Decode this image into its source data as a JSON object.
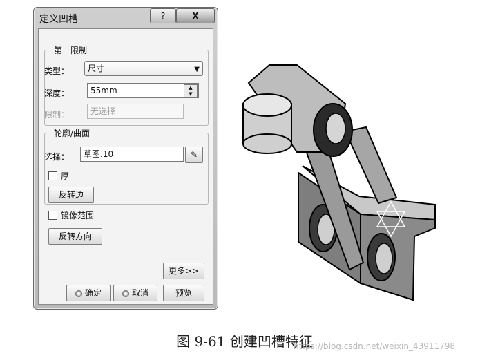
{
  "dialog": {
    "title": "定义凹槽",
    "help_label": "?",
    "close_label": "X",
    "first_limit": {
      "legend": "第一限制",
      "type_label": "类型：",
      "type_value": "尺寸",
      "depth_label": "深度：",
      "depth_value": "55mm",
      "limit_label": "限制：",
      "limit_value": "无选择"
    },
    "profile": {
      "legend": "轮廓/曲面",
      "select_label": "选择：",
      "select_value": "草图.10",
      "thick_label": "厚",
      "reverse_side_label": "反转边"
    },
    "mirror_label": "镜像范围",
    "reverse_direction_label": "反转方向",
    "more_label": "更多>>",
    "ok_label": "确定",
    "cancel_label": "取消",
    "preview_label": "预览"
  },
  "caption": "图 9-61   创建凹槽特征",
  "watermark": "https://blog.csdn.net/weixin_43911798"
}
